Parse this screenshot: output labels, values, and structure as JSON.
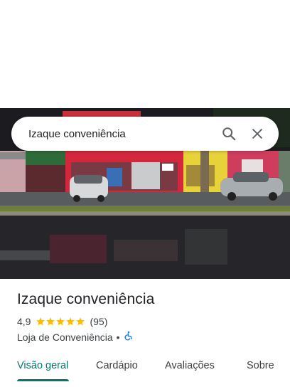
{
  "search": {
    "query": "Izaque conveniência"
  },
  "place": {
    "name": "Izaque conveniência",
    "rating": "4,9",
    "stars": 5,
    "review_count": "(95)",
    "category": "Loja de Conveniência",
    "separator": "•",
    "star_color": "#fbbc04"
  },
  "tabs": [
    {
      "label": "Visão geral",
      "active": true
    },
    {
      "label": "Cardápio",
      "active": false
    },
    {
      "label": "Avaliações",
      "active": false
    },
    {
      "label": "Sobre",
      "active": false
    }
  ],
  "colors": {
    "accent": "#00796b",
    "text_primary": "#202124",
    "text_secondary": "#3c4043",
    "accessibility_icon": "#1a73e8"
  },
  "icons": {
    "search": "search-icon",
    "close": "close-icon",
    "star": "star-icon",
    "accessibility": "wheelchair-icon"
  }
}
